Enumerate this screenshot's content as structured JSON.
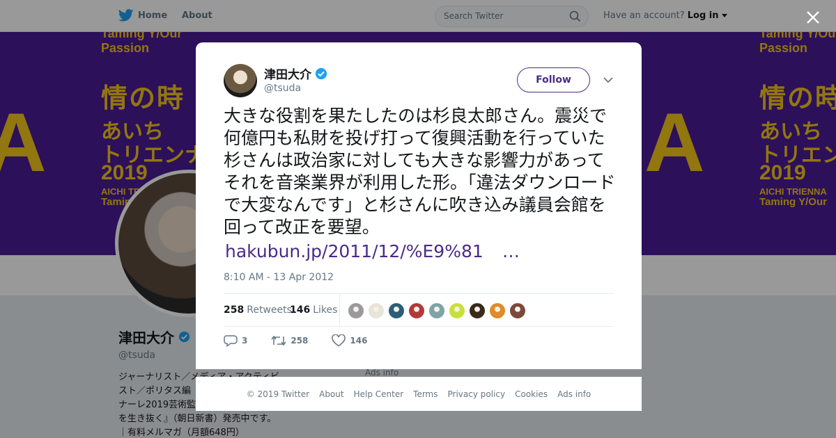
{
  "topbar": {
    "home_label": "Home",
    "about_label": "About",
    "search_placeholder": "Search Twitter",
    "account_prompt": "Have an account?",
    "login_label": "Log in"
  },
  "banner": {
    "line1": "Taming Y/Our Passion",
    "line2": "情の時",
    "line3": "あいち",
    "line4": "トリエンナ",
    "line5": "2019",
    "line6": "AICHI TRIENNA",
    "line7": "Taming Y/Our"
  },
  "profile": {
    "name": "津田大介",
    "handle": "@tsuda",
    "bio": [
      "ジャーナリスト／メディア・アクティビ",
      "スト／ポリタス編",
      "ナーレ2019芸術監",
      "を生き抜く』（朝日新書）発売中です。",
      "｜有料メルマガ（月額648円）"
    ],
    "ads_info": "Ads info"
  },
  "tweet": {
    "author_name": "津田大介",
    "author_handle": "@tsuda",
    "follow_label": "Follow",
    "text": "大きな役割を果たしたのは杉良太郎さん。震災で何億円も私財を投げ打って復興活動を行っていた杉さんは政治家に対しても大きな影響力があってそれを音楽業界が利用した形。「違法ダウンロードで大変なんです」と杉さんに吹き込み議員会館を回って改正を要望。",
    "link": "hakubun.jp/2011/12/%E9%81",
    "link_ellipsis": "…",
    "timestamp": "8:10 AM - 13 Apr 2012",
    "retweets_count": "258",
    "retweets_label": "Retweets",
    "likes_count": "146",
    "likes_label": "Likes",
    "reply_count": "3",
    "retweet_action_count": "258",
    "like_action_count": "146",
    "liker_avatars": [
      "#9a9a9a",
      "#e7e4d8",
      "#2c5d7a",
      "#b23a3a",
      "#7fa3a6",
      "#c8e03a",
      "#3a2a1a",
      "#e08a2a",
      "#7a4a3a"
    ]
  },
  "footer": {
    "links": [
      "© 2019 Twitter",
      "About",
      "Help Center",
      "Terms",
      "Privacy policy",
      "Cookies",
      "Ads info"
    ]
  },
  "colors": {
    "accent": "#4a2a8a",
    "twitter_blue": "#1da1f2",
    "banner_bg": "#4a1b96",
    "banner_text": "#f3c51a"
  }
}
